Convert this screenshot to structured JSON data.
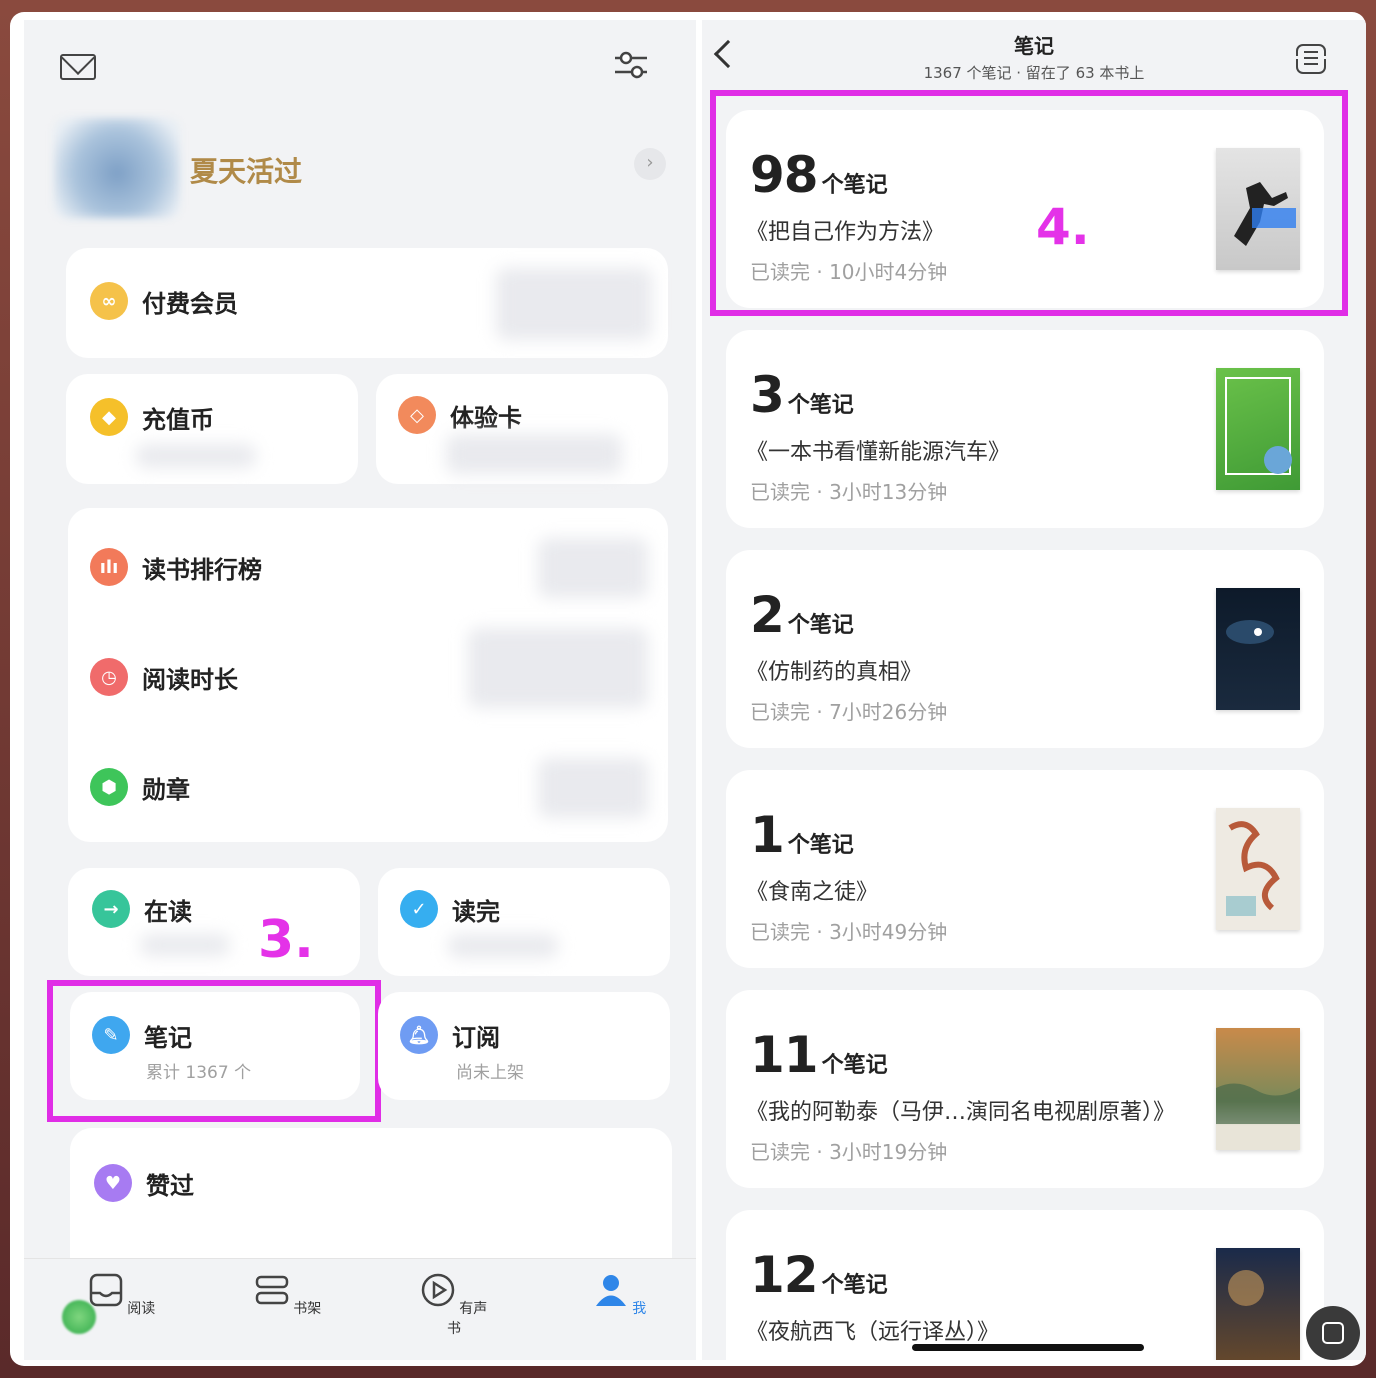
{
  "left": {
    "username": "夏天活过",
    "menu": {
      "membership": "付费会员",
      "coins": "充值币",
      "trial": "体验卡",
      "ranking": "读书排行榜",
      "read_time": "阅读时长",
      "badges": "勋章",
      "reading": "在读",
      "finished": "读完",
      "notes": "笔记",
      "notes_sub": "累计 1367 个",
      "subscribe": "订阅",
      "subscribe_sub": "尚未上架",
      "liked": "赞过"
    },
    "annotation": "3.",
    "tabs": [
      "阅读",
      "书架",
      "有声书",
      "我"
    ]
  },
  "right": {
    "title": "笔记",
    "subtitle": "1367 个笔记 · 留在了 63 本书上",
    "annotation": "4.",
    "unit": "个笔记",
    "notes": [
      {
        "count": "98",
        "book": "《把自己作为方法》",
        "meta": "已读完 · 10小时4分钟"
      },
      {
        "count": "3",
        "book": "《一本书看懂新能源汽车》",
        "meta": "已读完 · 3小时13分钟"
      },
      {
        "count": "2",
        "book": "《仿制药的真相》",
        "meta": "已读完 · 7小时26分钟"
      },
      {
        "count": "1",
        "book": "《食南之徒》",
        "meta": "已读完 · 3小时49分钟"
      },
      {
        "count": "11",
        "book": "《我的阿勒泰（马伊…演同名电视剧原著）》",
        "meta": "已读完 · 3小时19分钟"
      },
      {
        "count": "12",
        "book": "《夜航西飞（远行译丛）》",
        "meta": ""
      }
    ]
  },
  "colors": {
    "accent_magenta": "#e02de6",
    "username_gold": "#b08a48"
  }
}
